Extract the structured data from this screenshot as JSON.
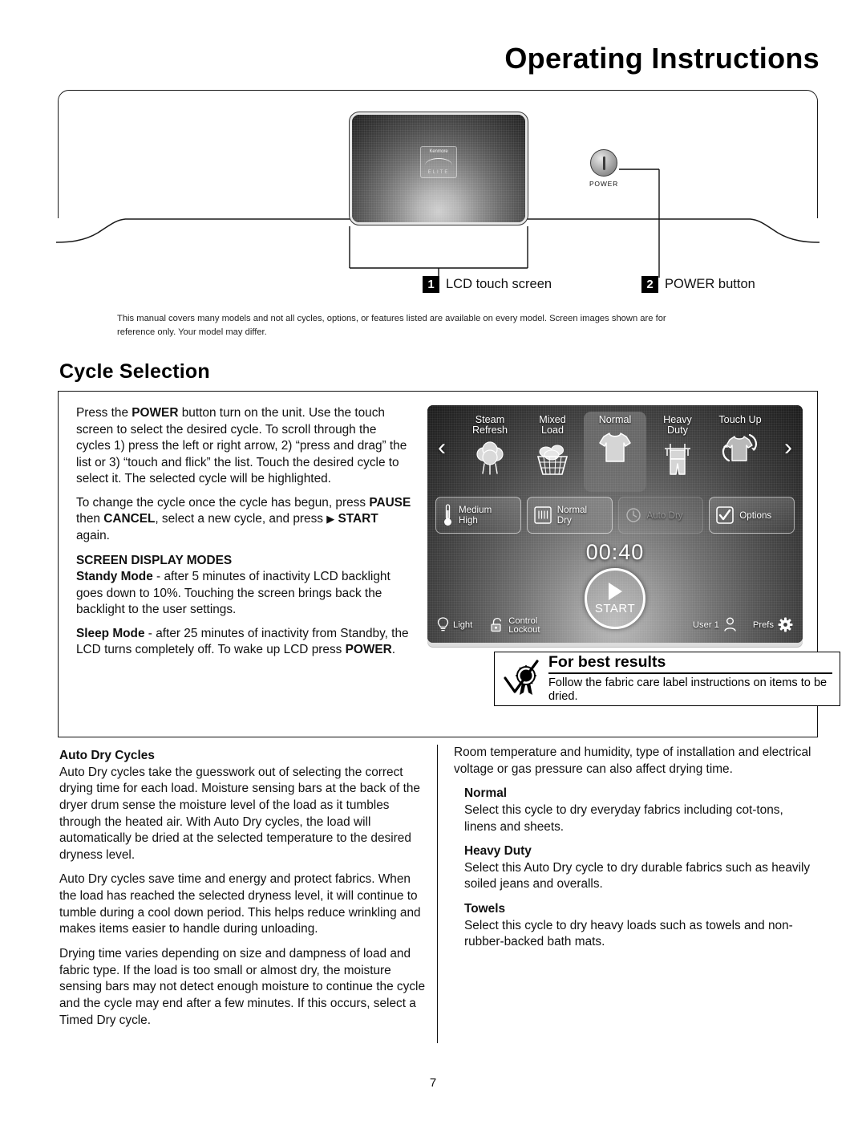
{
  "page": {
    "title": "Operating Instructions",
    "number": "7"
  },
  "figure": {
    "power_label": "POWER",
    "brand_top": "Kenmore",
    "brand_bottom": "ELITE",
    "callouts": [
      {
        "num": "1",
        "label": "LCD touch screen"
      },
      {
        "num": "2",
        "label": "POWER button"
      }
    ],
    "disclaimer": "This manual covers many models and not all cycles, options, or features listed are available on every model. Screen images shown are for reference only. Your model may differ."
  },
  "section": {
    "heading": "Cycle Selection",
    "paragraph_1_parts": {
      "a": "Press the ",
      "power": "POWER",
      "b": " button turn on the unit. Use the touch screen to select the desired cycle. To scroll through the cycles 1) press the left or right arrow, 2) “press and drag” the list or 3) “touch and flick” the list. Touch the desired cycle to select it. The selected cycle will be highlighted."
    },
    "paragraph_2_parts": {
      "a": "To change the cycle once the cycle has begun, press ",
      "pause": "PAUSE",
      "b": " then ",
      "cancel": "CANCEL",
      "c": ", select a new cycle, and press ",
      "start": "START",
      "d": " again."
    },
    "modes_heading": "SCREEN DISPLAY MODES",
    "standby_parts": {
      "label": "Standy Mode",
      "text": " - after 5 minutes of inactivity LCD backlight goes down to 10%. Touching the screen brings back the backlight to the user settings."
    },
    "sleep_parts": {
      "label": "Sleep Mode",
      "text_a": " - after 25 minutes of inactivity from Standby, the LCD turns completely off. To wake up LCD press ",
      "power": "POWER",
      "text_b": "."
    }
  },
  "lcd": {
    "arrow_left": "‹",
    "arrow_right": "›",
    "cycles": [
      {
        "name_line1": "Steam",
        "name_line2": "Refresh",
        "icon": "steam-icon",
        "selected": false
      },
      {
        "name_line1": "Mixed",
        "name_line2": "Load",
        "icon": "laundry-basket-icon",
        "selected": false
      },
      {
        "name_line1": "Normal",
        "name_line2": "",
        "icon": "tshirt-icon",
        "selected": true
      },
      {
        "name_line1": "Heavy",
        "name_line2": "Duty",
        "icon": "overalls-icon",
        "selected": false
      },
      {
        "name_line1": "Touch Up",
        "name_line2": "",
        "icon": "tshirt-refresh-icon",
        "selected": false
      }
    ],
    "options": [
      {
        "line1": "Medium",
        "line2": "High",
        "icon": "thermometer-icon",
        "dimmed": false
      },
      {
        "line1": "Normal",
        "line2": "Dry",
        "icon": "dryness-icon",
        "dimmed": false
      },
      {
        "line1": "Auto Dry",
        "line2": "",
        "icon": "clock-icon",
        "dimmed": true
      },
      {
        "line1": "Options",
        "line2": "",
        "icon": "checkbox-icon",
        "dimmed": false
      }
    ],
    "timer": "00:40",
    "start_label": "START",
    "bottom_bar": {
      "light": "Light",
      "lockout_line1": "Control",
      "lockout_line2": "Lockout",
      "user": "User 1",
      "prefs": "Prefs"
    }
  },
  "best_results": {
    "title": "For best results",
    "text": "Follow the fabric care label instructions on items to be dried."
  },
  "bottom_left": {
    "heading": "Auto Dry Cycles",
    "p1": "Auto Dry cycles take the guesswork out of selecting the correct drying time for each load. Moisture sensing bars at the back of the dryer drum sense the moisture level of the load as it tumbles through the heated air. With Auto Dry cycles, the load will automatically be dried at the selected temperature to the desired dryness level.",
    "p2": "Auto Dry cycles save time and energy and protect fabrics. When the load has reached the selected dryness level, it will continue to tumble during a cool down period. This helps reduce wrinkling and makes items easier to handle during unloading.",
    "p3": "Drying time varies depending on size and dampness of load and fabric type. If the load is too small or almost dry, the moisture sensing bars may not detect enough moisture to continue the cycle and the cycle may end after a few minutes. If this occurs, select a Timed Dry cycle."
  },
  "bottom_right": {
    "intro": "Room temperature and humidity, type of installation and electrical voltage or gas pressure can also affect drying time.",
    "entries": [
      {
        "title": "Normal",
        "body": "Select this cycle to dry everyday fabrics including cot-tons, linens and sheets."
      },
      {
        "title": "Heavy Duty",
        "body": "Select this Auto Dry cycle to dry durable fabrics such as heavily soiled jeans and overalls."
      },
      {
        "title": "Towels",
        "body": "Select this cycle to dry heavy loads such as towels and non-rubber-backed bath mats."
      }
    ]
  }
}
